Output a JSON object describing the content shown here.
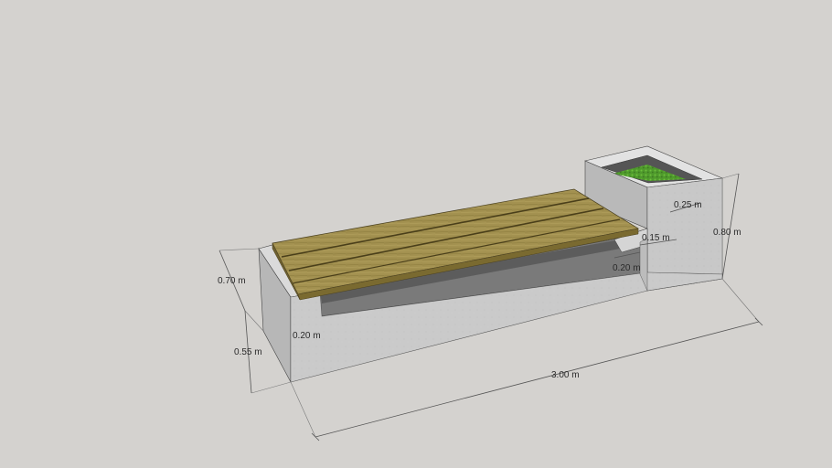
{
  "dimensions": {
    "total_length": "3.00 m",
    "bench_height": "0.55 m",
    "bench_depth": "0.70 m",
    "planter_height": "0.80 m",
    "planter_wall": "0.25 m",
    "step_height": "0.15 m",
    "step_depth": "0.20 m",
    "support_wall": "0.20 m"
  },
  "colors": {
    "background": "#d4d2cf",
    "concrete_front": "#c9c9c9",
    "concrete_side": "#b4b4b4",
    "concrete_top": "#dcdcdc",
    "wood": "#9c8a4a",
    "wood_dark": "#6e6030",
    "shadow": "#5c5c5c",
    "planter_soil": "#4a8a2a"
  }
}
